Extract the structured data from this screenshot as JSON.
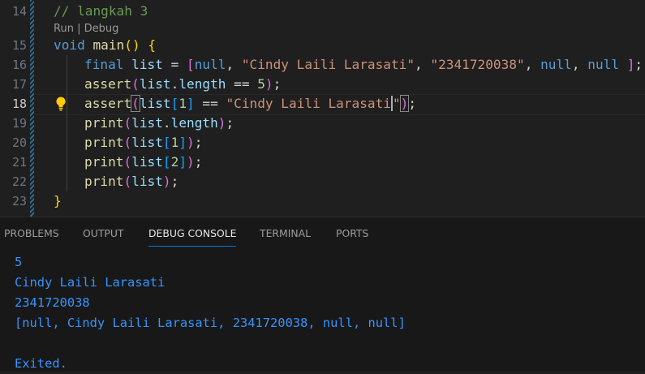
{
  "editor": {
    "line_numbers": [
      "14",
      "15",
      "16",
      "17",
      "18",
      "19",
      "20",
      "21",
      "22",
      "23"
    ],
    "active_line": "18",
    "codelens": {
      "run": "Run",
      "sep": " | ",
      "debug": "Debug"
    },
    "code": {
      "l14": {
        "comment": "// langkah 3"
      },
      "l15": {
        "kw": "void",
        "fn": "main",
        "open": "(",
        "close": ")",
        "brace": "{"
      },
      "l16": {
        "kw": "final",
        "var": "list",
        "eq": " = ",
        "lb": "[",
        "null1": "null",
        "s1": "\"Cindy Laili Larasati\"",
        "s2": "\"2341720038\"",
        "null2": "null",
        "null3": "null",
        "rb": "]",
        "semi": ";",
        "comma": ", "
      },
      "l17": {
        "fn": "assert",
        "var": "list",
        "prop": "length",
        "op": " == ",
        "num": "5"
      },
      "l18": {
        "fn": "assert",
        "var": "list",
        "idx": "1",
        "op": " == ",
        "str_open": "\"Cindy Laili Larasati",
        "str_close": "\""
      },
      "l19": {
        "fn": "print",
        "var": "list",
        "prop": "length"
      },
      "l20": {
        "fn": "print",
        "var": "list",
        "idx": "1"
      },
      "l21": {
        "fn": "print",
        "var": "list",
        "idx": "2"
      },
      "l22": {
        "fn": "print",
        "var": "list"
      },
      "l23": {
        "brace": "}"
      }
    },
    "lightbulb_icon": "lightbulb-icon"
  },
  "panel": {
    "tabs": [
      "PROBLEMS",
      "OUTPUT",
      "DEBUG CONSOLE",
      "TERMINAL",
      "PORTS"
    ],
    "active_tab": "DEBUG CONSOLE",
    "console_lines": [
      "5",
      "Cindy Laili Larasati",
      "2341720038",
      "[null, Cindy Laili Larasati, 2341720038, null, null]",
      "",
      "Exited."
    ],
    "console_color": "#3794ff"
  }
}
